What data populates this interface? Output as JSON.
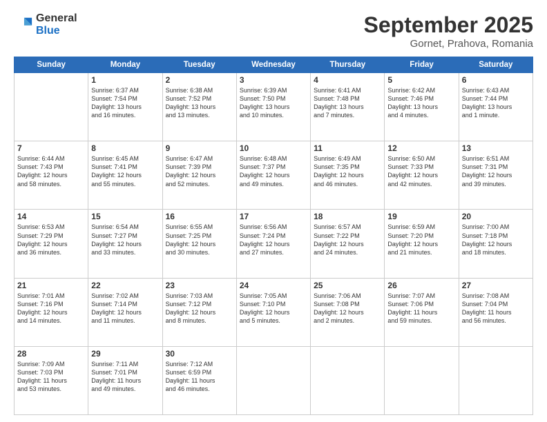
{
  "logo": {
    "line1": "General",
    "line2": "Blue"
  },
  "header": {
    "month": "September 2025",
    "location": "Gornet, Prahova, Romania"
  },
  "weekdays": [
    "Sunday",
    "Monday",
    "Tuesday",
    "Wednesday",
    "Thursday",
    "Friday",
    "Saturday"
  ],
  "weeks": [
    [
      {
        "day": "",
        "info": ""
      },
      {
        "day": "1",
        "info": "Sunrise: 6:37 AM\nSunset: 7:54 PM\nDaylight: 13 hours\nand 16 minutes."
      },
      {
        "day": "2",
        "info": "Sunrise: 6:38 AM\nSunset: 7:52 PM\nDaylight: 13 hours\nand 13 minutes."
      },
      {
        "day": "3",
        "info": "Sunrise: 6:39 AM\nSunset: 7:50 PM\nDaylight: 13 hours\nand 10 minutes."
      },
      {
        "day": "4",
        "info": "Sunrise: 6:41 AM\nSunset: 7:48 PM\nDaylight: 13 hours\nand 7 minutes."
      },
      {
        "day": "5",
        "info": "Sunrise: 6:42 AM\nSunset: 7:46 PM\nDaylight: 13 hours\nand 4 minutes."
      },
      {
        "day": "6",
        "info": "Sunrise: 6:43 AM\nSunset: 7:44 PM\nDaylight: 13 hours\nand 1 minute."
      }
    ],
    [
      {
        "day": "7",
        "info": "Sunrise: 6:44 AM\nSunset: 7:43 PM\nDaylight: 12 hours\nand 58 minutes."
      },
      {
        "day": "8",
        "info": "Sunrise: 6:45 AM\nSunset: 7:41 PM\nDaylight: 12 hours\nand 55 minutes."
      },
      {
        "day": "9",
        "info": "Sunrise: 6:47 AM\nSunset: 7:39 PM\nDaylight: 12 hours\nand 52 minutes."
      },
      {
        "day": "10",
        "info": "Sunrise: 6:48 AM\nSunset: 7:37 PM\nDaylight: 12 hours\nand 49 minutes."
      },
      {
        "day": "11",
        "info": "Sunrise: 6:49 AM\nSunset: 7:35 PM\nDaylight: 12 hours\nand 46 minutes."
      },
      {
        "day": "12",
        "info": "Sunrise: 6:50 AM\nSunset: 7:33 PM\nDaylight: 12 hours\nand 42 minutes."
      },
      {
        "day": "13",
        "info": "Sunrise: 6:51 AM\nSunset: 7:31 PM\nDaylight: 12 hours\nand 39 minutes."
      }
    ],
    [
      {
        "day": "14",
        "info": "Sunrise: 6:53 AM\nSunset: 7:29 PM\nDaylight: 12 hours\nand 36 minutes."
      },
      {
        "day": "15",
        "info": "Sunrise: 6:54 AM\nSunset: 7:27 PM\nDaylight: 12 hours\nand 33 minutes."
      },
      {
        "day": "16",
        "info": "Sunrise: 6:55 AM\nSunset: 7:25 PM\nDaylight: 12 hours\nand 30 minutes."
      },
      {
        "day": "17",
        "info": "Sunrise: 6:56 AM\nSunset: 7:24 PM\nDaylight: 12 hours\nand 27 minutes."
      },
      {
        "day": "18",
        "info": "Sunrise: 6:57 AM\nSunset: 7:22 PM\nDaylight: 12 hours\nand 24 minutes."
      },
      {
        "day": "19",
        "info": "Sunrise: 6:59 AM\nSunset: 7:20 PM\nDaylight: 12 hours\nand 21 minutes."
      },
      {
        "day": "20",
        "info": "Sunrise: 7:00 AM\nSunset: 7:18 PM\nDaylight: 12 hours\nand 18 minutes."
      }
    ],
    [
      {
        "day": "21",
        "info": "Sunrise: 7:01 AM\nSunset: 7:16 PM\nDaylight: 12 hours\nand 14 minutes."
      },
      {
        "day": "22",
        "info": "Sunrise: 7:02 AM\nSunset: 7:14 PM\nDaylight: 12 hours\nand 11 minutes."
      },
      {
        "day": "23",
        "info": "Sunrise: 7:03 AM\nSunset: 7:12 PM\nDaylight: 12 hours\nand 8 minutes."
      },
      {
        "day": "24",
        "info": "Sunrise: 7:05 AM\nSunset: 7:10 PM\nDaylight: 12 hours\nand 5 minutes."
      },
      {
        "day": "25",
        "info": "Sunrise: 7:06 AM\nSunset: 7:08 PM\nDaylight: 12 hours\nand 2 minutes."
      },
      {
        "day": "26",
        "info": "Sunrise: 7:07 AM\nSunset: 7:06 PM\nDaylight: 11 hours\nand 59 minutes."
      },
      {
        "day": "27",
        "info": "Sunrise: 7:08 AM\nSunset: 7:04 PM\nDaylight: 11 hours\nand 56 minutes."
      }
    ],
    [
      {
        "day": "28",
        "info": "Sunrise: 7:09 AM\nSunset: 7:03 PM\nDaylight: 11 hours\nand 53 minutes."
      },
      {
        "day": "29",
        "info": "Sunrise: 7:11 AM\nSunset: 7:01 PM\nDaylight: 11 hours\nand 49 minutes."
      },
      {
        "day": "30",
        "info": "Sunrise: 7:12 AM\nSunset: 6:59 PM\nDaylight: 11 hours\nand 46 minutes."
      },
      {
        "day": "",
        "info": ""
      },
      {
        "day": "",
        "info": ""
      },
      {
        "day": "",
        "info": ""
      },
      {
        "day": "",
        "info": ""
      }
    ]
  ]
}
